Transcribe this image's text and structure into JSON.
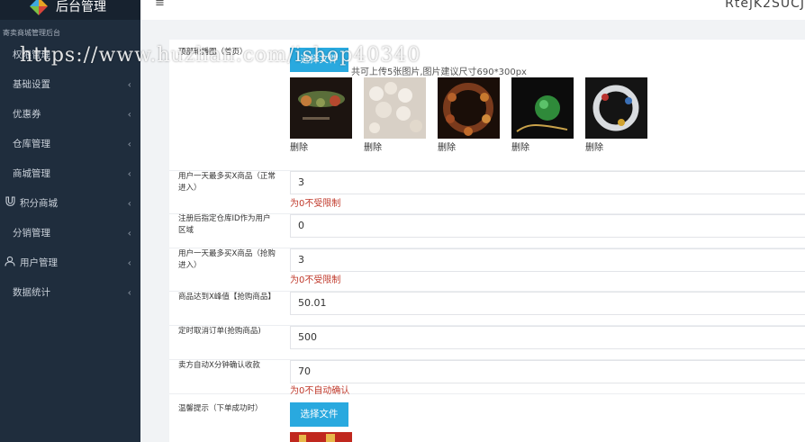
{
  "app": {
    "title": "后台管理",
    "subtitle": "寄卖商城管理后台",
    "user": "RtejK2SUCJ",
    "menu_icon": "hamburger-icon"
  },
  "sidebar": {
    "items": [
      {
        "label": "权限管理",
        "icon": ""
      },
      {
        "label": "基础设置",
        "icon": ""
      },
      {
        "label": "优惠券",
        "icon": ""
      },
      {
        "label": "仓库管理",
        "icon": ""
      },
      {
        "label": "商城管理",
        "icon": ""
      },
      {
        "label": "积分商城",
        "icon": "magnet-icon"
      },
      {
        "label": "分销管理",
        "icon": ""
      },
      {
        "label": "用户管理",
        "icon": "user-icon"
      },
      {
        "label": "数据统计",
        "icon": ""
      }
    ]
  },
  "form": {
    "banner": {
      "label": "顶部轮播图（首页）",
      "button": "选择文件",
      "tip": "共可上传5张图片,图片建议尺寸690*300px",
      "delete_label": "删除"
    },
    "daily_limit_normal": {
      "label": "用户一天最多买X商品（正常进入）",
      "value": "3",
      "hint": "为0不受限制"
    },
    "warehouse_region": {
      "label": "注册后指定仓库ID作为用户区域",
      "value": "0"
    },
    "daily_limit_rush": {
      "label": "用户一天最多买X商品（抢购进入）",
      "value": "3",
      "hint": "为0不受限制"
    },
    "peak_price": {
      "label": "商品达到X峰值【抢购商品】",
      "value": "50.01"
    },
    "auto_cancel": {
      "label": "定时取消订单(抢购商品)",
      "value": "500"
    },
    "auto_confirm": {
      "label": "卖方自动X分钟确认收款",
      "value": "70",
      "hint": "为0不自动确认"
    },
    "warm_tip": {
      "label": "温馨提示（下单成功时）",
      "button": "选择文件"
    }
  },
  "watermark": "https://www.huzhan.com/ishop40340",
  "colors": {
    "sidebar_bg": "#1f2d3d",
    "accent": "#29a9df",
    "hint_red": "#c0392b"
  }
}
